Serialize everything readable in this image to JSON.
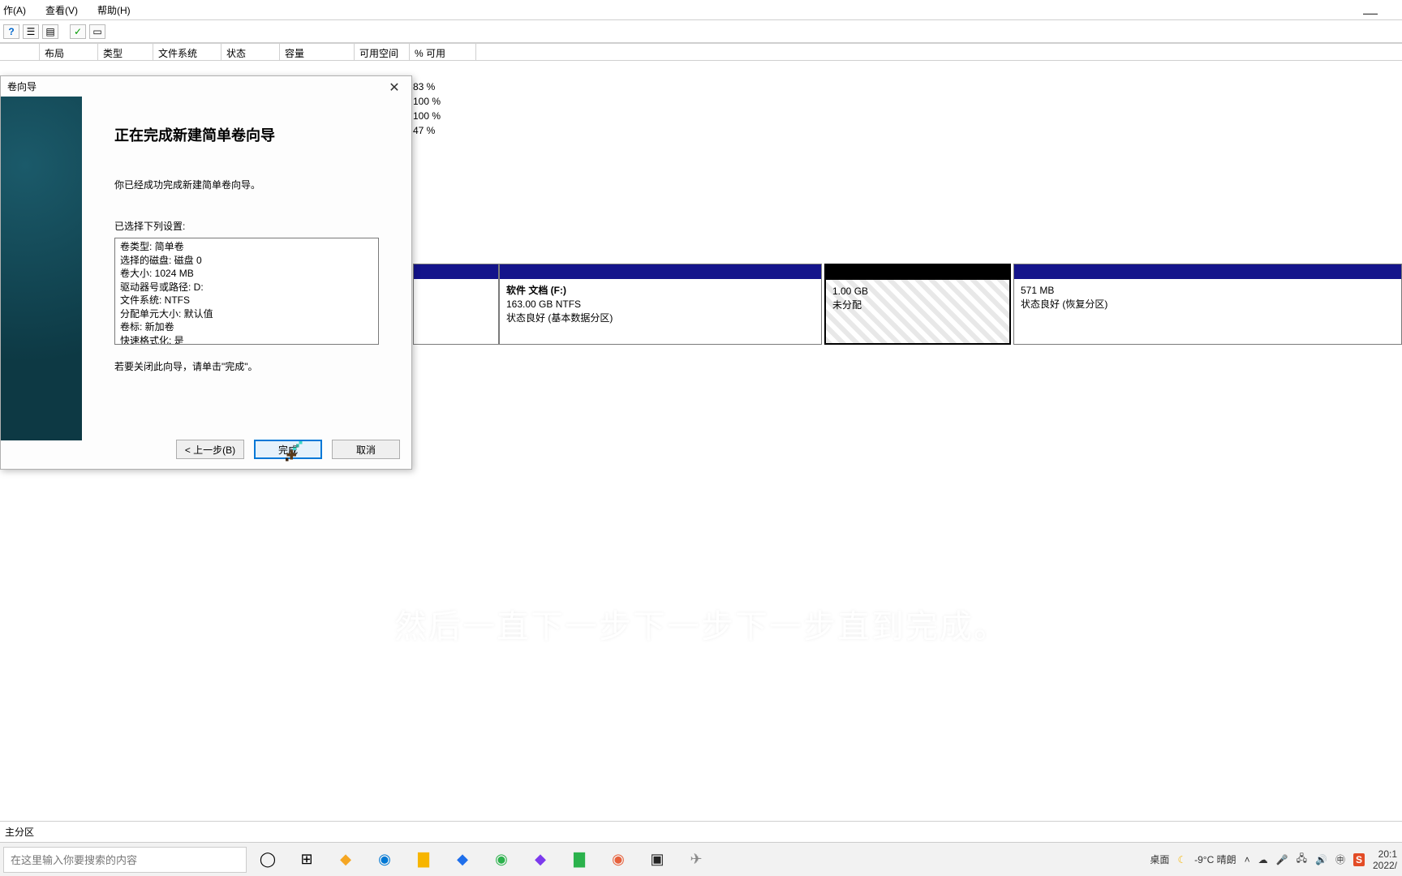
{
  "window": {
    "minimize_glyph": "—"
  },
  "menubar": {
    "action": "作(A)",
    "view": "查看(V)",
    "help": "帮助(H)"
  },
  "toolbar_icons": [
    "?",
    "☰",
    "▤",
    "✓",
    "▭"
  ],
  "columns": {
    "layout": "布局",
    "type": "类型",
    "filesystem": "文件系统",
    "status": "状态",
    "capacity": "容量",
    "freespace": "可用空间",
    "pctfree": "% 可用"
  },
  "pct_rows": [
    "83 %",
    "100 %",
    "100 %",
    "47 %"
  ],
  "partitions": {
    "f": {
      "title": "软件  文档  (F:)",
      "line2": "163.00 GB NTFS",
      "line3": "状态良好 (基本数据分区)"
    },
    "unalloc": {
      "line2": "1.00 GB",
      "line3": "未分配"
    },
    "recovery": {
      "line2": "571 MB",
      "line3": "状态良好 (恢复分区)"
    }
  },
  "wizard": {
    "titlebar": "卷向导",
    "close": "✕",
    "heading": "正在完成新建简单卷向导",
    "success_msg": "你已经成功完成新建简单卷向导。",
    "settings_label": "已选择下列设置:",
    "settings_lines": [
      "卷类型: 简单卷",
      "选择的磁盘: 磁盘 0",
      "卷大小: 1024 MB",
      "驱动器号或路径: D:",
      "文件系统: NTFS",
      "分配单元大小: 默认值",
      "卷标: 新加卷",
      "快速格式化: 是"
    ],
    "close_hint": "若要关闭此向导，请单击\"完成\"。",
    "buttons": {
      "back": "< 上一步(B)",
      "finish": "完成",
      "cancel": "取消"
    }
  },
  "subtitle": "然后一直下一步下一步下一步直到完成。",
  "legend": "主分区",
  "taskbar": {
    "search_placeholder": "在这里输入你要搜索的内容",
    "weather": "-9°C 晴朗",
    "desktop_label": "桌面",
    "clock_time": "20:1",
    "clock_date": "2022/"
  }
}
